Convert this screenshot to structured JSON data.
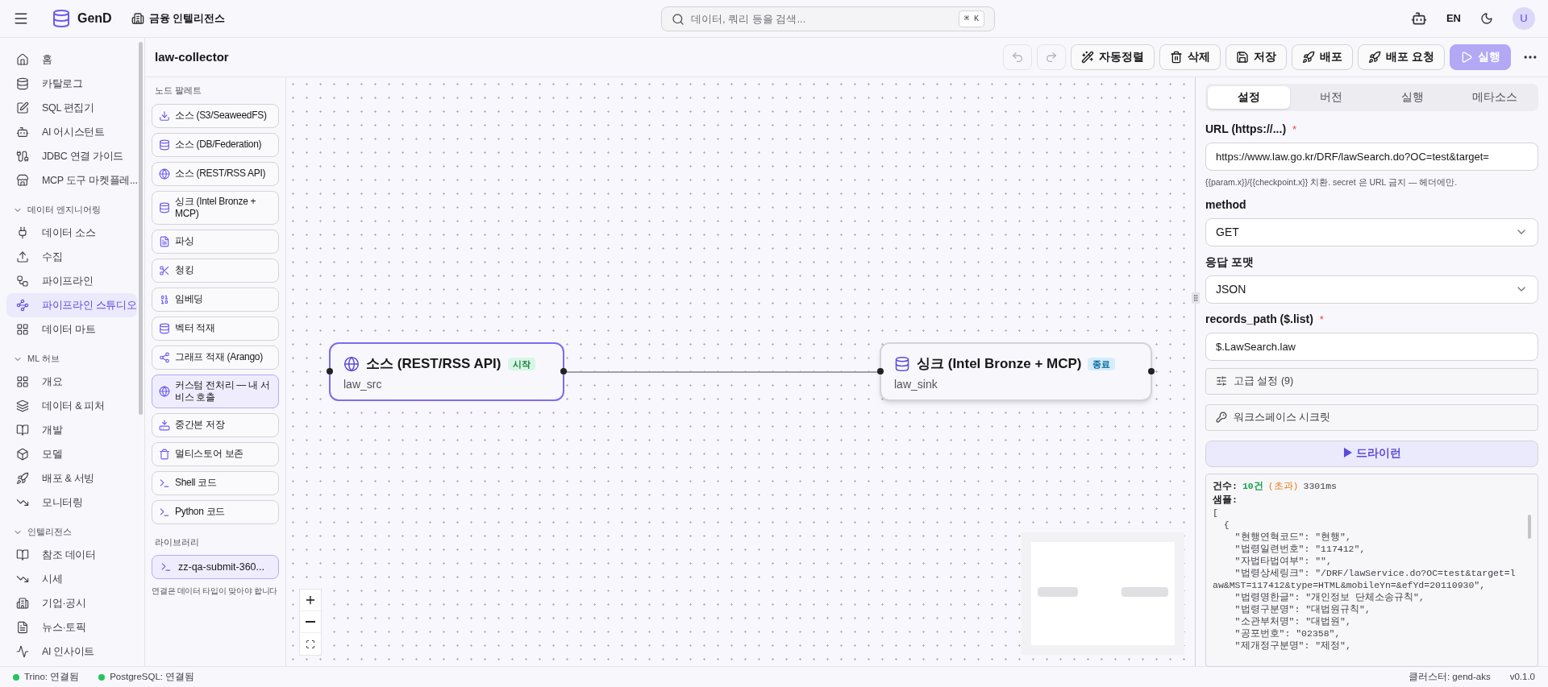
{
  "header": {
    "app_name": "GenD",
    "workspace": "금융 인텔리전스",
    "search": {
      "placeholder": "데이터, 쿼리 등을 검색...",
      "shortcut": "⌘ K"
    },
    "language": "EN",
    "avatar": "U"
  },
  "sidebar": {
    "items": [
      {
        "label": "홈",
        "selected": false
      },
      {
        "label": "카탈로그",
        "selected": false
      },
      {
        "label": "SQL 편집기",
        "selected": false
      },
      {
        "label": "AI 어시스턴트",
        "selected": false
      },
      {
        "label": "JDBC 연결 가이드",
        "selected": false
      },
      {
        "label": "MCP 도구 마켓플레...",
        "selected": false
      }
    ],
    "sections": [
      {
        "title": "데이터 엔지니어링",
        "expanded": true,
        "items": [
          {
            "label": "데이터 소스",
            "selected": false
          },
          {
            "label": "수집",
            "selected": false
          },
          {
            "label": "파이프라인",
            "selected": false
          },
          {
            "label": "파이프라인 스튜디오",
            "selected": true
          },
          {
            "label": "데이터 마트",
            "selected": false
          }
        ]
      },
      {
        "title": "ML 허브",
        "expanded": true,
        "items": [
          {
            "label": "개요",
            "selected": false
          },
          {
            "label": "데이터 & 피처",
            "selected": false
          },
          {
            "label": "개발",
            "selected": false
          },
          {
            "label": "모델",
            "selected": false
          },
          {
            "label": "배포 & 서빙",
            "selected": false
          },
          {
            "label": "모니터링",
            "selected": false
          }
        ]
      },
      {
        "title": "인텔리전스",
        "expanded": true,
        "items": [
          {
            "label": "참조 데이터",
            "selected": false
          },
          {
            "label": "시세",
            "selected": false
          },
          {
            "label": "기업·공시",
            "selected": false
          },
          {
            "label": "뉴스·토픽",
            "selected": false
          },
          {
            "label": "AI 인사이트",
            "selected": false
          }
        ]
      }
    ]
  },
  "pipeline": {
    "title": "law-collector"
  },
  "toolbar": [
    {
      "kind": "undo",
      "disabled": true
    },
    {
      "kind": "redo",
      "disabled": true
    },
    {
      "kind": "button",
      "label": "자동정렬",
      "disabled": false
    },
    {
      "kind": "button",
      "label": "삭제",
      "disabled": false
    },
    {
      "kind": "button",
      "label": "저장",
      "disabled": false
    },
    {
      "kind": "button",
      "label": "배포",
      "disabled": false
    },
    {
      "kind": "button",
      "label": "배포 요청",
      "disabled": false
    },
    {
      "kind": "primary",
      "label": "실행",
      "disabled": true
    },
    {
      "kind": "more",
      "disabled": false
    }
  ],
  "palette": {
    "title": "노드 팔레트",
    "items": [
      {
        "label": "소스 (S3/SeaweedFS)",
        "selected": false
      },
      {
        "label": "소스 (DB/Federation)",
        "selected": false
      },
      {
        "label": "소스 (REST/RSS API)",
        "selected": false
      },
      {
        "label": "싱크 (Intel Bronze + MCP)",
        "selected": false
      },
      {
        "label": "파싱",
        "selected": false
      },
      {
        "label": "청킹",
        "selected": false
      },
      {
        "label": "임베딩",
        "selected": false
      },
      {
        "label": "벡터 적재",
        "selected": false
      },
      {
        "label": "그래프 적재 (Arango)",
        "selected": false
      },
      {
        "label": "커스텀 전처리 — 내 서비스 호출",
        "selected": true
      },
      {
        "label": "중간본 저장",
        "selected": false
      },
      {
        "label": "멀티스토어 보존",
        "selected": false
      },
      {
        "label": "Shell 코드",
        "selected": false
      },
      {
        "label": "Python 코드",
        "selected": false
      }
    ],
    "library_title": "라이브러리",
    "library": [
      {
        "label": "zz-qa-submit-360...",
        "selected": true
      }
    ],
    "hint": "연결은 데이터 타입이 맞아야 합니다"
  },
  "canvas": {
    "nodes": [
      {
        "kind": "source",
        "title": "소스 (REST/RSS API)",
        "badge": "시작",
        "subtitle": "law_src",
        "selected": true
      },
      {
        "kind": "sink",
        "title": "싱크 (Intel Bronze + MCP)",
        "badge": "종료",
        "subtitle": "law_sink",
        "selected": false
      }
    ]
  },
  "panel": {
    "tabs": [
      {
        "label": "설정",
        "selected": true
      },
      {
        "label": "버전",
        "selected": false
      },
      {
        "label": "실행",
        "selected": false
      },
      {
        "label": "메타소스",
        "selected": false
      }
    ],
    "fields": [
      {
        "kind": "text",
        "label": "URL (https://...)",
        "required": true,
        "value": "https://www.law.go.kr/DRF/lawSearch.do?OC=test&target=",
        "hint": "{{param.x}}/{{checkpoint.x}} 치환. secret 은 URL 금지 — 헤더에만."
      },
      {
        "kind": "select",
        "label": "method",
        "required": false,
        "value": "GET"
      },
      {
        "kind": "select",
        "label": "응답 포맷",
        "required": false,
        "value": "JSON"
      },
      {
        "kind": "text",
        "label": "records_path ($.list)",
        "required": true,
        "value": "$.LawSearch.law"
      }
    ],
    "required_mark": "*",
    "sections": [
      {
        "label": "고급 설정 (9)"
      },
      {
        "label": "워크스페이스 시크릿"
      }
    ],
    "dry_run": "▶ 드라이런",
    "result": {
      "count_label": "건수:",
      "count": "10건",
      "flag": "(초과)",
      "duration": "3301ms",
      "sample_label": "샘플:",
      "lines": [
        "[",
        "  {",
        "    \"현행연혁코드\": \"현행\",",
        "    \"법령일련번호\": \"117412\",",
        "    \"자법타법여부\": \"\",",
        "    \"법령상세링크\": \"/DRF/lawService.do?OC=test&target=law&MST=117412&type=HTML&mobileYn=&efYd=20110930\",",
        "    \"법령명한글\": \"개인정보 단체소송규칙\",",
        "    \"법령구분명\": \"대법원규칙\",",
        "    \"소관부처명\": \"대법원\",",
        "    \"공포번호\": \"02358\",",
        "    \"제개정구분명\": \"제정\","
      ]
    }
  },
  "status_bar": {
    "connections": [
      {
        "label": "Trino: 연결됨",
        "connected": true
      },
      {
        "label": "PostgreSQL: 연결됨",
        "connected": true
      }
    ],
    "cluster": "클러스터: gend-aks",
    "version": "v0.1.0"
  }
}
